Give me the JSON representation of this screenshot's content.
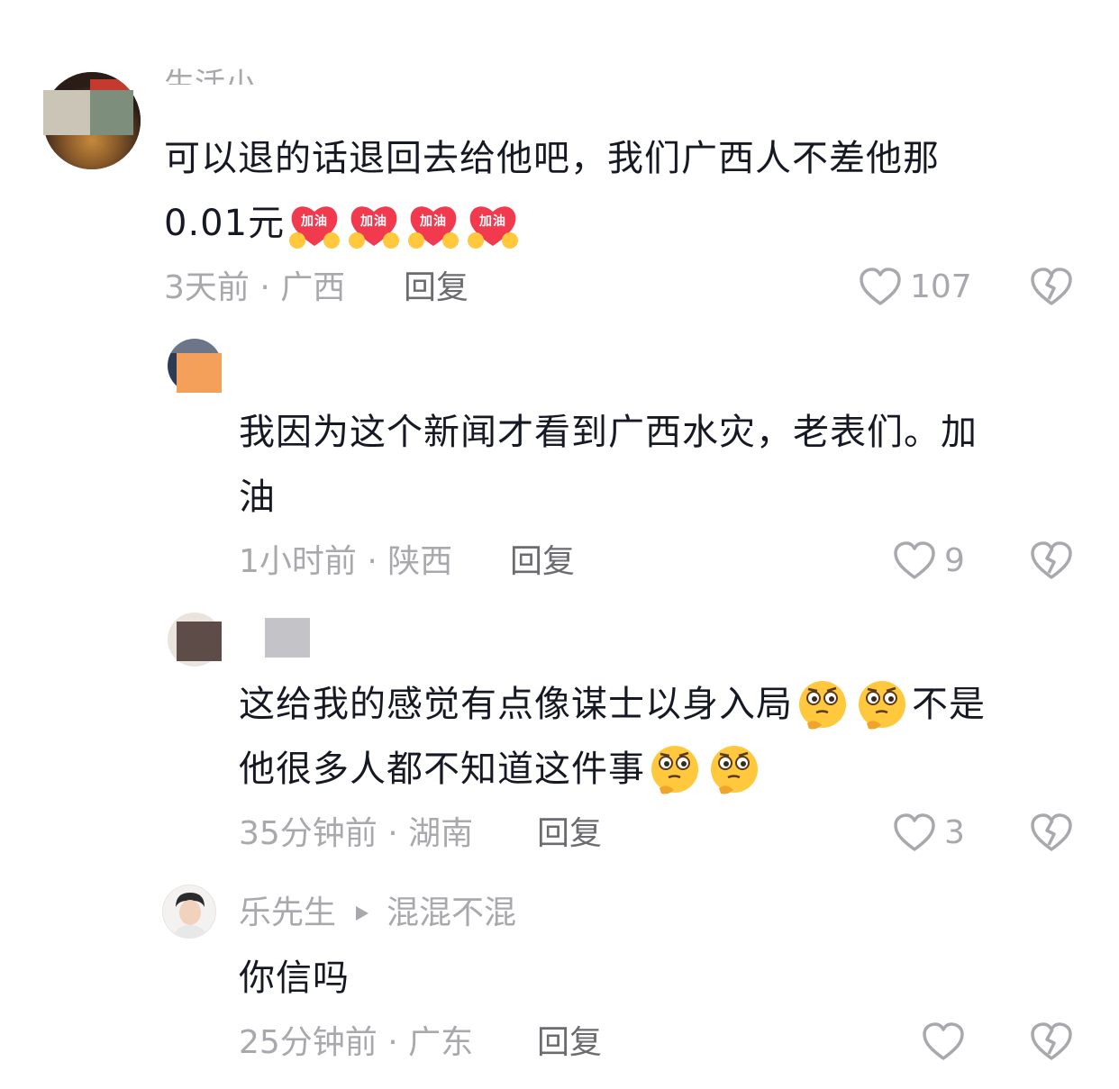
{
  "comments": [
    {
      "username": "生活小...",
      "text_line1": "可以退的话退回去给他吧，我们广西人不差他那",
      "text_line2": "0.01元",
      "emojis": [
        "加油",
        "加油",
        "加油",
        "加油"
      ],
      "time": "3天前",
      "location": "广西",
      "reply_label": "回复",
      "likes": "107"
    },
    {
      "text_line1": "我因为这个新闻才看到广西水灾，老表们。加",
      "text_line2": "油",
      "time": "1小时前",
      "location": "陕西",
      "reply_label": "回复",
      "likes": "9"
    },
    {
      "text_line1": "这给我的感觉有点像谋士以身入局",
      "text_line1_tail": "不是",
      "text_line2": "他很多人都不知道这件事",
      "time": "35分钟前",
      "location": "湖南",
      "reply_label": "回复",
      "likes": "3"
    },
    {
      "username": "乐先生",
      "reply_to": "混混不混",
      "text_line1": "你信吗",
      "time": "25分钟前",
      "location": "广东",
      "reply_label": "回复",
      "likes": ""
    }
  ],
  "separator": "·",
  "colors": {
    "text": "#161823",
    "meta": "#a9a9ad",
    "reply": "#6b6b70",
    "emoji_red": "#f23a4f",
    "emoji_yellow": "#ffc83d"
  },
  "icons": [
    "heart-icon",
    "dislike-icon",
    "arrow-right-icon",
    "jiayou-emoji",
    "thinking-emoji"
  ]
}
